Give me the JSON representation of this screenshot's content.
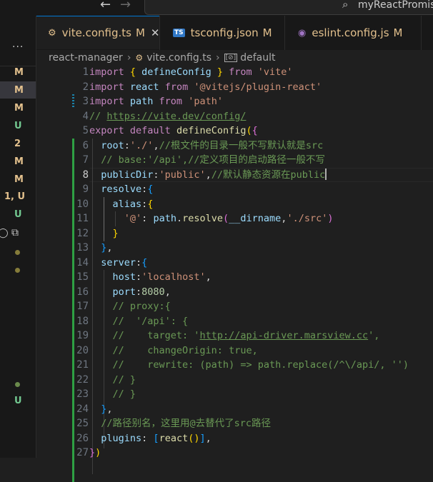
{
  "titlebar": {
    "search_text": "myReactPromise",
    "back_icon": "arrow-left-icon",
    "forward_icon": "arrow-right-icon"
  },
  "explorer": {
    "more_label": "···",
    "git_status": [
      {
        "label": "M",
        "color": "#e2c08d"
      },
      {
        "label": "M",
        "color": "#e2c08d"
      },
      {
        "label": "M",
        "color": "#e2c08d"
      },
      {
        "label": "U",
        "color": "#73c991"
      },
      {
        "label": "2",
        "color": "#e2c08d"
      },
      {
        "label": "M",
        "color": "#e2c08d"
      },
      {
        "label": "M",
        "color": "#e2c08d"
      },
      {
        "label": "1, U",
        "color": "#e2c08d"
      },
      {
        "label": "U",
        "color": "#73c991"
      }
    ],
    "bottom_badge": {
      "label": "U",
      "color": "#73c991"
    }
  },
  "tabs": [
    {
      "icon": "⚙",
      "icon_color": "#e2c08d",
      "name": "vite.config.ts",
      "state": "M",
      "close": "✕",
      "active": true
    },
    {
      "icon": "TS",
      "icon_color": "#3178c6",
      "name": "tsconfig.json",
      "state": "M",
      "close": "",
      "active": false
    },
    {
      "icon": "◉",
      "icon_color": "#a074c4",
      "name": "eslint.config.js",
      "state": "M",
      "close": "",
      "active": false
    }
  ],
  "breadcrumb": {
    "folder": "react-manager",
    "file": "vite.config.ts",
    "symbol_icon": "[⊘]",
    "symbol": "default"
  },
  "editor": {
    "current_line": 8,
    "line_numbers": [
      "1",
      "2",
      "3",
      "4",
      "5",
      "6",
      "7",
      "8",
      "9",
      "10",
      "11",
      "12",
      "13",
      "14",
      "15",
      "16",
      "17",
      "18",
      "19",
      "20",
      "21",
      "22",
      "23",
      "24",
      "25",
      "26",
      "27"
    ],
    "lines": [
      [
        [
          "import ",
          "kw"
        ],
        [
          "{ ",
          "b1"
        ],
        [
          "defineConfig ",
          "id"
        ],
        [
          "} ",
          "b1"
        ],
        [
          "from ",
          "kw"
        ],
        [
          "'vite'",
          "str"
        ]
      ],
      [
        [
          "import ",
          "kw"
        ],
        [
          "react ",
          "id"
        ],
        [
          "from ",
          "kw"
        ],
        [
          "'@vitejs/plugin-react'",
          "str"
        ]
      ],
      [
        [
          "import ",
          "kw"
        ],
        [
          "path ",
          "id"
        ],
        [
          "from ",
          "kw"
        ],
        [
          "'path'",
          "str"
        ]
      ],
      [
        [
          "// ",
          "com"
        ],
        [
          "https://vite.dev/config/",
          "com link"
        ]
      ],
      [
        [
          "export ",
          "kw"
        ],
        [
          "default ",
          "kw"
        ],
        [
          "defineConfig",
          "fn"
        ],
        [
          "(",
          "b1"
        ],
        [
          "{",
          "b2"
        ]
      ],
      [
        [
          "  root",
          "id"
        ],
        [
          ":",
          "p"
        ],
        [
          "'./'",
          "str"
        ],
        [
          ",",
          "p"
        ],
        [
          "//根文件的目录一般不写默认就是src",
          "com"
        ]
      ],
      [
        [
          "  // base:'/api',//定义项目的启动路径一般不写",
          "com"
        ]
      ],
      [
        [
          "  publicDir",
          "id"
        ],
        [
          ":",
          "p"
        ],
        [
          "'public'",
          "str"
        ],
        [
          ",",
          "p"
        ],
        [
          "//默认静态资源在public",
          "com"
        ]
      ],
      [
        [
          "  resolve",
          "id"
        ],
        [
          ":",
          "p"
        ],
        [
          "{",
          "b3"
        ]
      ],
      [
        [
          "    alias",
          "id"
        ],
        [
          ":",
          "p"
        ],
        [
          "{",
          "b1"
        ]
      ],
      [
        [
          "      ",
          "p"
        ],
        [
          "'@'",
          "str"
        ],
        [
          ": ",
          "p"
        ],
        [
          "path",
          "id"
        ],
        [
          ".",
          "p"
        ],
        [
          "resolve",
          "fn"
        ],
        [
          "(",
          "b2"
        ],
        [
          "__dirname",
          "id"
        ],
        [
          ",",
          "p"
        ],
        [
          "'./src'",
          "str"
        ],
        [
          ")",
          "b2"
        ]
      ],
      [
        [
          "    ",
          "p"
        ],
        [
          "}",
          "b1"
        ]
      ],
      [
        [
          "  ",
          "p"
        ],
        [
          "}",
          "b3"
        ],
        [
          ",",
          "p"
        ]
      ],
      [
        [
          "  server",
          "id"
        ],
        [
          ":",
          "p"
        ],
        [
          "{",
          "b3"
        ]
      ],
      [
        [
          "    host",
          "id"
        ],
        [
          ":",
          "p"
        ],
        [
          "'localhost'",
          "str"
        ],
        [
          ",",
          "p"
        ]
      ],
      [
        [
          "    port",
          "id"
        ],
        [
          ":",
          "p"
        ],
        [
          "8080",
          "num"
        ],
        [
          ",",
          "p"
        ]
      ],
      [
        [
          "    // proxy:{",
          "com"
        ]
      ],
      [
        [
          "    //  '/api': {",
          "com"
        ]
      ],
      [
        [
          "    //    target: '",
          "com"
        ],
        [
          "http://api-driver.marsview.cc",
          "com link"
        ],
        [
          "',",
          "com"
        ]
      ],
      [
        [
          "    //    changeOrigin: true,",
          "com"
        ]
      ],
      [
        [
          "    //    rewrite: (path) => path.replace(/^\\/api/, '')",
          "com"
        ]
      ],
      [
        [
          "    // }",
          "com"
        ]
      ],
      [
        [
          "    // }",
          "com"
        ]
      ],
      [
        [
          "  ",
          "p"
        ],
        [
          "}",
          "b3"
        ],
        [
          ",",
          "p"
        ]
      ],
      [
        [
          "  //路径别名，这里用@去替代了src路径",
          "com"
        ]
      ],
      [
        [
          "  plugins",
          "id"
        ],
        [
          ": ",
          "p"
        ],
        [
          "[",
          "b3"
        ],
        [
          "react",
          "fn"
        ],
        [
          "(",
          "b1"
        ],
        [
          ")",
          "b1"
        ],
        [
          "]",
          "b3"
        ],
        [
          ",",
          "p"
        ]
      ],
      [
        [
          "}",
          "b2"
        ],
        [
          ")",
          "b1"
        ]
      ]
    ]
  }
}
